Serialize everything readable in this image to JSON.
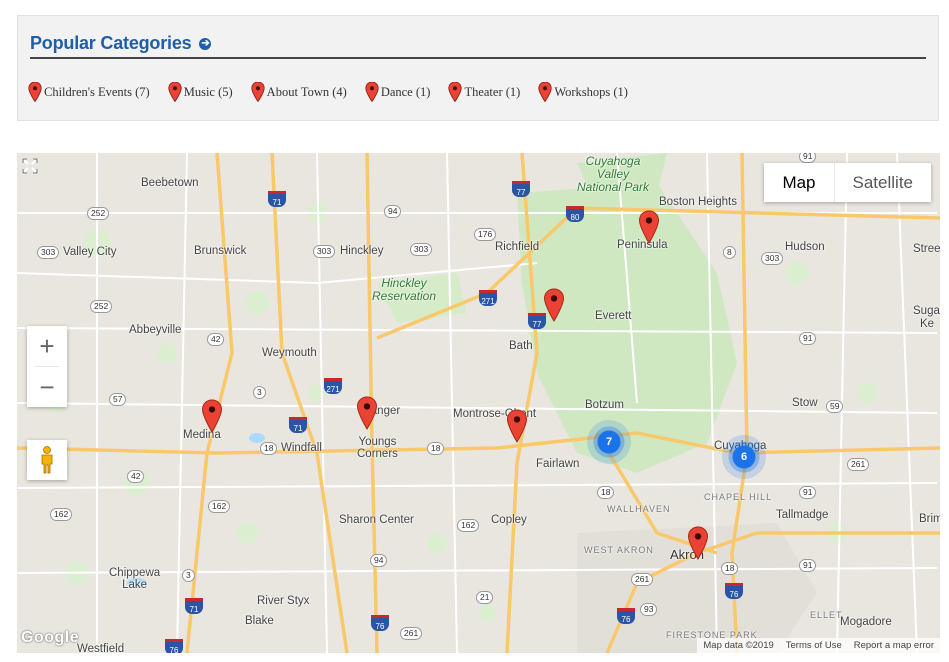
{
  "categories_panel": {
    "title": "Popular Categories",
    "arrow_icon": "circle-arrow-right-icon",
    "items": [
      {
        "label": "Children's Events (7)"
      },
      {
        "label": "Music (5)"
      },
      {
        "label": "About Town (4)"
      },
      {
        "label": "Dance (1)"
      },
      {
        "label": "Theater (1)"
      },
      {
        "label": "Workshops (1)"
      }
    ]
  },
  "map": {
    "type_buttons": {
      "map": "Map",
      "satellite": "Satellite",
      "active": "Map"
    },
    "zoom": {
      "in": "+",
      "out": "−"
    },
    "logo": "Google",
    "attribution": {
      "data": "Map data ©2019",
      "terms": "Terms of Use",
      "report": "Report a map error"
    },
    "places": {
      "beebetown": "Beebetown",
      "valley_city": "Valley City",
      "brunswick": "Brunswick",
      "hinckley": "Hinckley",
      "richfield": "Richfield",
      "boston_heights": "Boston Heights",
      "peninsula": "Peninsula",
      "hudson": "Hudson",
      "streetsboro": "Stree",
      "sugar": "Suga",
      "kent": "Ke",
      "hinckley_res": "Hinckley\nReservation",
      "cuyahoga_valley": "Cuyahoga\nValley\nNational Park",
      "everett": "Everett",
      "abbeyville": "Abbeyville",
      "weymouth": "Weymouth",
      "bath": "Bath",
      "stow": "Stow",
      "medina": "Medina",
      "windfall": "Windfall",
      "granger": "Granger",
      "youngs_corners": "Youngs\nCorners",
      "montrose": "Montrose-Ghent",
      "botzum": "Botzum",
      "fairlawn": "Fairlawn",
      "cuyahoga_falls": "Cuyahoga",
      "chapel_hill": "CHAPEL HILL",
      "wallhaven": "WALLHAVEN",
      "tallmadge": "Tallmadge",
      "brimfield": "Brim",
      "sharon_center": "Sharon Center",
      "copley": "Copley",
      "west_akron": "WEST AKRON",
      "akron": "Akron",
      "chippewa_lake": "Chippewa\nLake",
      "river_styx": "River Styx",
      "blake": "Blake",
      "firestone_park": "FIRESTONE PARK",
      "ellet": "ELLET",
      "mogadore": "Mogadore",
      "westfield": "Westfield"
    },
    "clusters": [
      {
        "count": "7"
      },
      {
        "count": "6"
      }
    ],
    "colors": {
      "pin": "#ea4335",
      "cluster": "#1a73e8",
      "park": "#c8e6b8",
      "highway": "#f9c86b",
      "road": "#ffffff"
    }
  }
}
